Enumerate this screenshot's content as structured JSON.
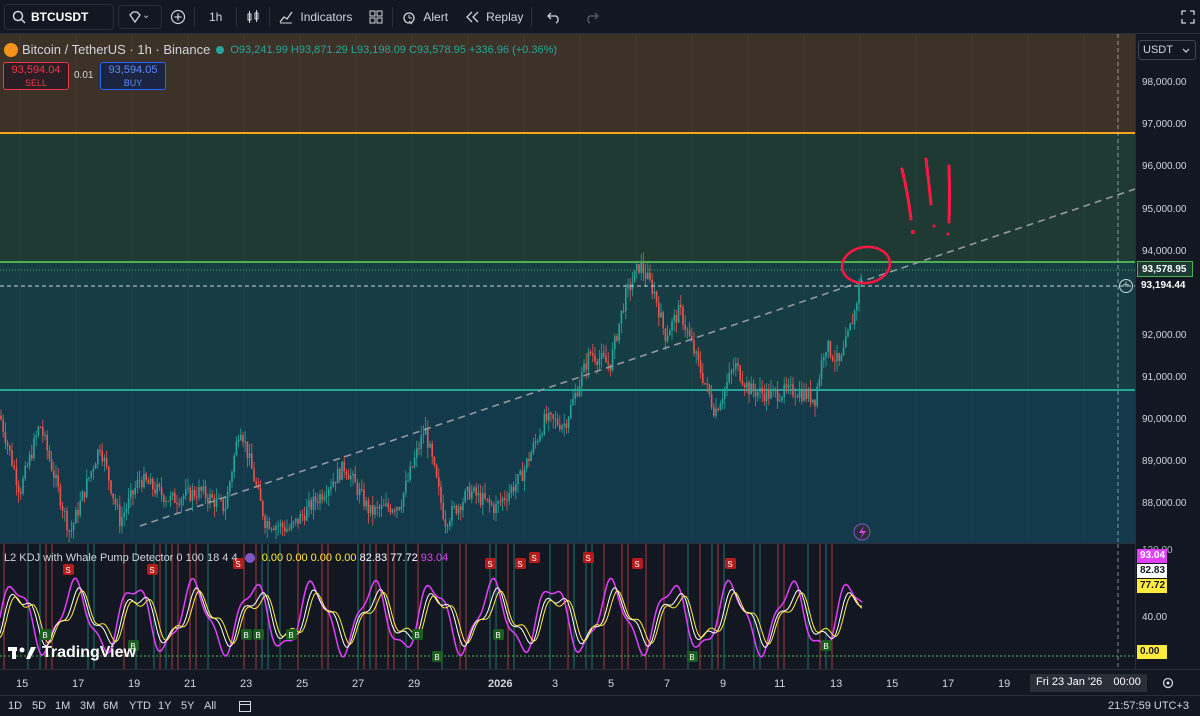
{
  "toolbar": {
    "symbol": "BTCUSDT",
    "interval": "1h",
    "indicators": "Indicators",
    "alert": "Alert",
    "replay": "Replay"
  },
  "legend": {
    "title": "Bitcoin / TetherUS · 1h · Binance",
    "open": "O93,241.99",
    "high": "H93,871.29",
    "low": "L93,198.09",
    "close": "C93,578.95",
    "change": "+336.96 (+0.36%)"
  },
  "trade": {
    "sell_price": "93,594.04",
    "sell_label": "SELL",
    "spread": "0.01",
    "buy_price": "93,594.05",
    "buy_label": "BUY"
  },
  "price_axis": {
    "currency": "USDT",
    "ticks": [
      "98,000.00",
      "97,000.00",
      "96,000.00",
      "95,000.00",
      "94,000.00",
      "92,000.00",
      "91,000.00",
      "90,000.00",
      "89,000.00",
      "88,000.00"
    ],
    "last_price": "93,578.95",
    "crosshair_price": "93,194.44"
  },
  "indicator": {
    "title": "L2 KDJ with Whale Pump Detector 0 100 18 4 4",
    "values_yellow": "0.00  0.00  0.00  0.00",
    "values_white": "82.83  77.72",
    "value_magenta": "93.04",
    "axis_ticks": [
      "120.00",
      "40.00"
    ],
    "labels": [
      "93.04",
      "82.83",
      "77.72",
      "0.00"
    ],
    "signal_letters": {
      "sell": "S",
      "buy": "B"
    }
  },
  "brand": "TradingView",
  "time_axis": {
    "ticks": [
      "15",
      "17",
      "19",
      "21",
      "23",
      "25",
      "27",
      "29",
      "2026",
      "3",
      "5",
      "7",
      "9",
      "11",
      "13",
      "15",
      "17",
      "19"
    ],
    "cursor_date": "Fri 23 Jan '26",
    "cursor_time": "00:00"
  },
  "ranges": [
    "1D",
    "5D",
    "1M",
    "3M",
    "YTD",
    "1Y",
    "5Y",
    "All"
  ],
  "clock": "21:57:59 UTC+3",
  "annotation_text": "!!!",
  "colors": {
    "up": "#26a69a",
    "down": "#ef5350",
    "orange_level": "#f7a21b",
    "green_level": "#4caf50",
    "teal_level": "#26a69a",
    "annotation": "#ff1744"
  }
}
